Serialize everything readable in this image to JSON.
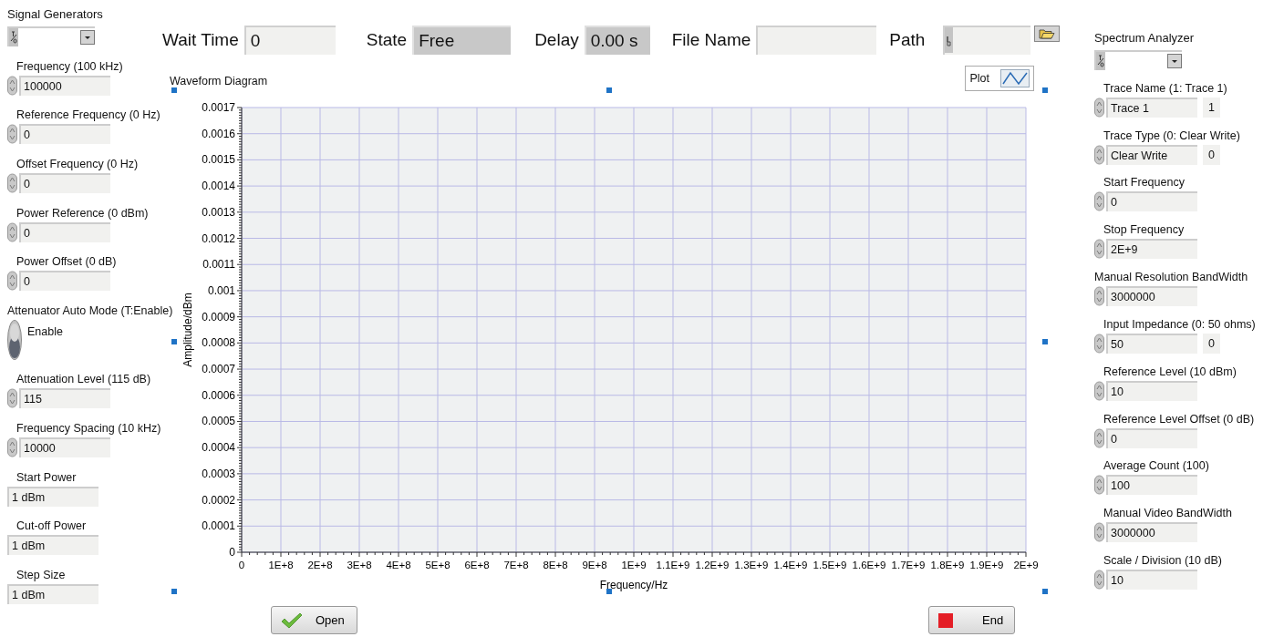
{
  "signal_generators": {
    "title": "Signal Generators",
    "controls": [
      {
        "kind": "numeric",
        "label": "Frequency (100 kHz)",
        "value": "100000"
      },
      {
        "kind": "numeric",
        "label": "Reference Frequency (0 Hz)",
        "value": "0"
      },
      {
        "kind": "numeric",
        "label": "Offset Frequency (0 Hz)",
        "value": "0"
      },
      {
        "kind": "numeric",
        "label": "Power Reference (0 dBm)",
        "value": "0"
      },
      {
        "kind": "numeric",
        "label": "Power Offset (0 dB)",
        "value": "0"
      },
      {
        "kind": "toggle",
        "label": "Attenuator Auto Mode (T:Enable)",
        "toggle_label": "Enable",
        "on": false
      },
      {
        "kind": "numeric",
        "label": "Attenuation Level (115 dB)",
        "value": "115"
      },
      {
        "kind": "numeric",
        "label": "Frequency Spacing (10 kHz)",
        "value": "10000"
      },
      {
        "kind": "indicator",
        "label": "Start Power",
        "value": "1 dBm"
      },
      {
        "kind": "indicator",
        "label": "Cut-off Power",
        "value": "1 dBm"
      },
      {
        "kind": "indicator",
        "label": "Step Size",
        "value": "1 dBm"
      }
    ]
  },
  "top_bar": [
    {
      "kind": "numeric",
      "label": "Wait Time",
      "value": "0"
    },
    {
      "kind": "indicator",
      "label": "State",
      "value": "Free"
    },
    {
      "kind": "indicator",
      "label": "Delay",
      "value": "0.00 s"
    },
    {
      "kind": "string",
      "label": "File Name"
    },
    {
      "kind": "path",
      "label": "Path"
    }
  ],
  "waveform": {
    "title": "Waveform Diagram",
    "legend": "Plot",
    "chart_data": {
      "type": "line",
      "grid": true,
      "xlabel": "Frequency/Hz",
      "ylabel": "Amplitude/dBm",
      "xlim": [
        0,
        2000000000
      ],
      "ylim": [
        0,
        0.0017
      ],
      "xticks": [
        {
          "value": 0,
          "label": "0"
        },
        {
          "value": 100000000,
          "label": "1E+8"
        },
        {
          "value": 200000000,
          "label": "2E+8"
        },
        {
          "value": 300000000,
          "label": "3E+8"
        },
        {
          "value": 400000000,
          "label": "4E+8"
        },
        {
          "value": 500000000,
          "label": "5E+8"
        },
        {
          "value": 600000000,
          "label": "6E+8"
        },
        {
          "value": 700000000,
          "label": "7E+8"
        },
        {
          "value": 800000000,
          "label": "8E+8"
        },
        {
          "value": 900000000,
          "label": "9E+8"
        },
        {
          "value": 1000000000,
          "label": "1E+9"
        },
        {
          "value": 1100000000,
          "label": "1.1E+9"
        },
        {
          "value": 1200000000,
          "label": "1.2E+9"
        },
        {
          "value": 1300000000,
          "label": "1.3E+9"
        },
        {
          "value": 1400000000,
          "label": "1.4E+9"
        },
        {
          "value": 1500000000,
          "label": "1.5E+9"
        },
        {
          "value": 1600000000,
          "label": "1.6E+9"
        },
        {
          "value": 1700000000,
          "label": "1.7E+9"
        },
        {
          "value": 1800000000,
          "label": "1.8E+9"
        },
        {
          "value": 1900000000,
          "label": "1.9E+9"
        },
        {
          "value": 2000000000,
          "label": "2E+9"
        }
      ],
      "yticks": [
        0,
        0.0001,
        0.0002,
        0.0003,
        0.0004,
        0.0005,
        0.0006,
        0.0007,
        0.0008,
        0.0009,
        0.001,
        0.0011,
        0.0012,
        0.0013,
        0.0014,
        0.0015,
        0.0016,
        0.0017
      ]
    }
  },
  "buttons": [
    {
      "kind": "open",
      "label": "Open"
    },
    {
      "kind": "end",
      "label": "End"
    }
  ],
  "spectrum_analyzer": {
    "title": "Spectrum Analyzer",
    "controls": [
      {
        "kind": "numeric",
        "label": "Trace Name (1: Trace 1)",
        "value": "Trace 1",
        "index": "1"
      },
      {
        "kind": "numeric",
        "label": "Trace Type (0: Clear Write)",
        "value": "Clear Write",
        "index": "0"
      },
      {
        "kind": "numeric",
        "label": "Start Frequency",
        "value": "0"
      },
      {
        "kind": "numeric",
        "label": "Stop Frequency",
        "value": "2E+9"
      },
      {
        "kind": "numeric",
        "label": "Manual Resolution BandWidth",
        "value": "3000000"
      },
      {
        "kind": "numeric",
        "label": "Input Impedance (0: 50 ohms)",
        "value": "50",
        "index": "0"
      },
      {
        "kind": "numeric",
        "label": "Reference Level (10 dBm)",
        "value": "10"
      },
      {
        "kind": "numeric",
        "label": "Reference Level Offset (0 dB)",
        "value": "0"
      },
      {
        "kind": "numeric",
        "label": "Average Count (100)",
        "value": "100"
      },
      {
        "kind": "numeric",
        "label": "Manual Video BandWidth",
        "value": "3000000"
      },
      {
        "kind": "numeric",
        "label": "Scale / Division (10 dB)",
        "value": "10"
      }
    ]
  }
}
